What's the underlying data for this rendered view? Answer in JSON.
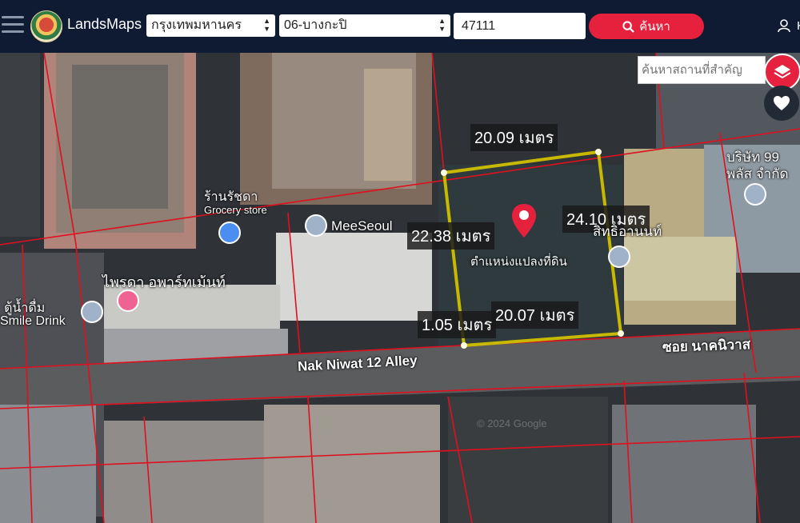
{
  "app": {
    "name": "LandsMaps"
  },
  "header": {
    "province_select": "กรุงเทพมหานคร",
    "district_select": "06-บางกะปิ",
    "parcel_code": "47111",
    "search_label": "ค้นหา",
    "user_label": "K"
  },
  "map": {
    "place_search_placeholder": "ค้นหาสถานที่สำคัญ",
    "measurements": {
      "top": "20.09 เมตร",
      "left": "22.38 เมตร",
      "right": "24.10 เมตร",
      "bottom": "20.07 เมตร",
      "small": "1.05 เมตร"
    },
    "parcel_marker_label": "ตำแหน่งแปลงที่ดิน",
    "pois": {
      "grocery_name": "ร้านรัชดา",
      "grocery_type": "Grocery store",
      "meeseoul": "MeeSeoul",
      "apartment": "ไพรดา อพาร์ทเม้นท์",
      "drink_th": "ตู้น้ำดื่ม",
      "drink_en": "Smile Drink",
      "company_line1": "บริษัท 99",
      "company_line2": "พลัส จำกัด",
      "shrine": "สิทธิอานนท์"
    },
    "roads": {
      "alley_en": "Nak Niwat 12 Alley",
      "alley_th": "ซอย นาคนิวาส"
    },
    "watermark": "© 2024 Google",
    "colors": {
      "header_bg": "#0e1b33",
      "search_button": "#e5213e",
      "parcel_boundary": "#c8b900",
      "cadastral_lines": "#e0101e",
      "layers_fab": "#e5213e"
    },
    "icons": [
      "menu-icon",
      "search-icon",
      "user-icon",
      "layers-icon",
      "heart-icon",
      "location-pin-icon",
      "shopping-cart-icon",
      "hotel-icon"
    ]
  }
}
